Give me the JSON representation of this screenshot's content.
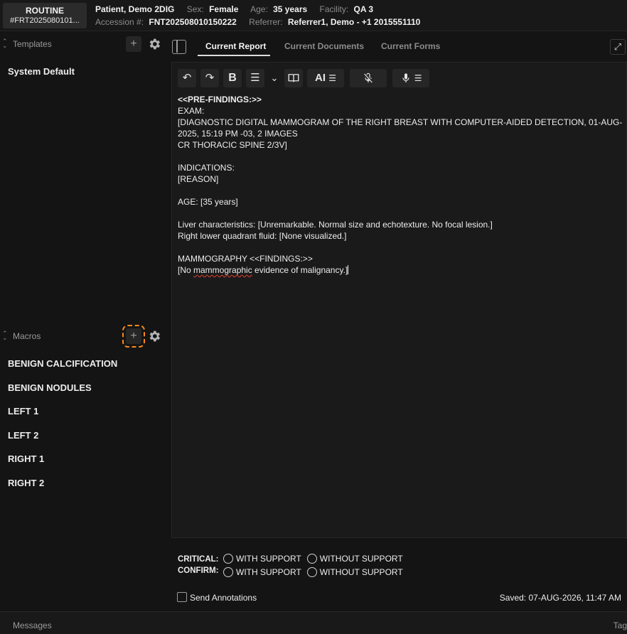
{
  "header": {
    "priority": "ROUTINE",
    "order_id": "#FRT2025080101...",
    "patient_name": "Patient, Demo 2DIG",
    "sex_label": "Sex:",
    "sex": "Female",
    "age_label": "Age:",
    "age": "35 years",
    "facility_label": "Facility:",
    "facility": "QA 3",
    "accession_label": "Accession #:",
    "accession": "FNT202508010150222",
    "referrer_label": "Referrer:",
    "referrer": "Referrer1, Demo - +1 2015551110"
  },
  "left_panel": {
    "templates": {
      "title": "Templates",
      "add_glyph": "+",
      "items": [
        "System Default"
      ]
    },
    "macros": {
      "title": "Macros",
      "add_glyph": "+",
      "items": [
        "BENIGN CALCIFICATION",
        "BENIGN NODULES",
        "LEFT 1",
        "LEFT 2",
        "RIGHT 1",
        "RIGHT 2"
      ]
    }
  },
  "tabs": [
    {
      "label": "Current Report",
      "active": true
    },
    {
      "label": "Current Documents",
      "active": false
    },
    {
      "label": "Current Forms",
      "active": false
    }
  ],
  "toolbar": {
    "undo": "↶",
    "redo": "↷",
    "bold": "B",
    "list": "☰",
    "dropdown": "⌄",
    "ai": "AI"
  },
  "report": {
    "pre_findings": "<<PRE-FINDINGS:>>",
    "exam_label": "EXAM:",
    "exam_line1": "[DIAGNOSTIC DIGITAL MAMMOGRAM OF THE RIGHT BREAST WITH COMPUTER-AIDED DETECTION, 01-AUG-2025, 15:19 PM -03, 2 IMAGES",
    "exam_line2": "CR THORACIC SPINE 2/3V]",
    "indications_label": "INDICATIONS:",
    "reason": "[REASON]",
    "age_line": "AGE: [35 years]",
    "liver_line": "Liver characteristics: [Unremarkable. Normal size and echotexture. No focal lesion.]",
    "fluid_line": "Right lower quadrant fluid: [None visualized.]",
    "mammo_heading": "MAMMOGRAPHY <<FINDINGS:>>",
    "finding_prefix": "[No ",
    "finding_misspelled": "mammographic",
    "finding_suffix": " evidence of malignancy.]"
  },
  "critical": {
    "critical_label": "CRITICAL:",
    "confirm_label": "CONFIRM:",
    "with_support": "WITH SUPPORT",
    "without_support": "WITHOUT SUPPORT"
  },
  "send_annotations_label": "Send Annotations",
  "saved_text": "Saved: 07-AUG-2026, 11:47 AM",
  "footer": {
    "messages": "Messages",
    "tag": "Tag"
  },
  "colors": {
    "focus_outline": "#ff8a1c",
    "background": "#141414",
    "editor_bg": "#1a1a1a"
  }
}
